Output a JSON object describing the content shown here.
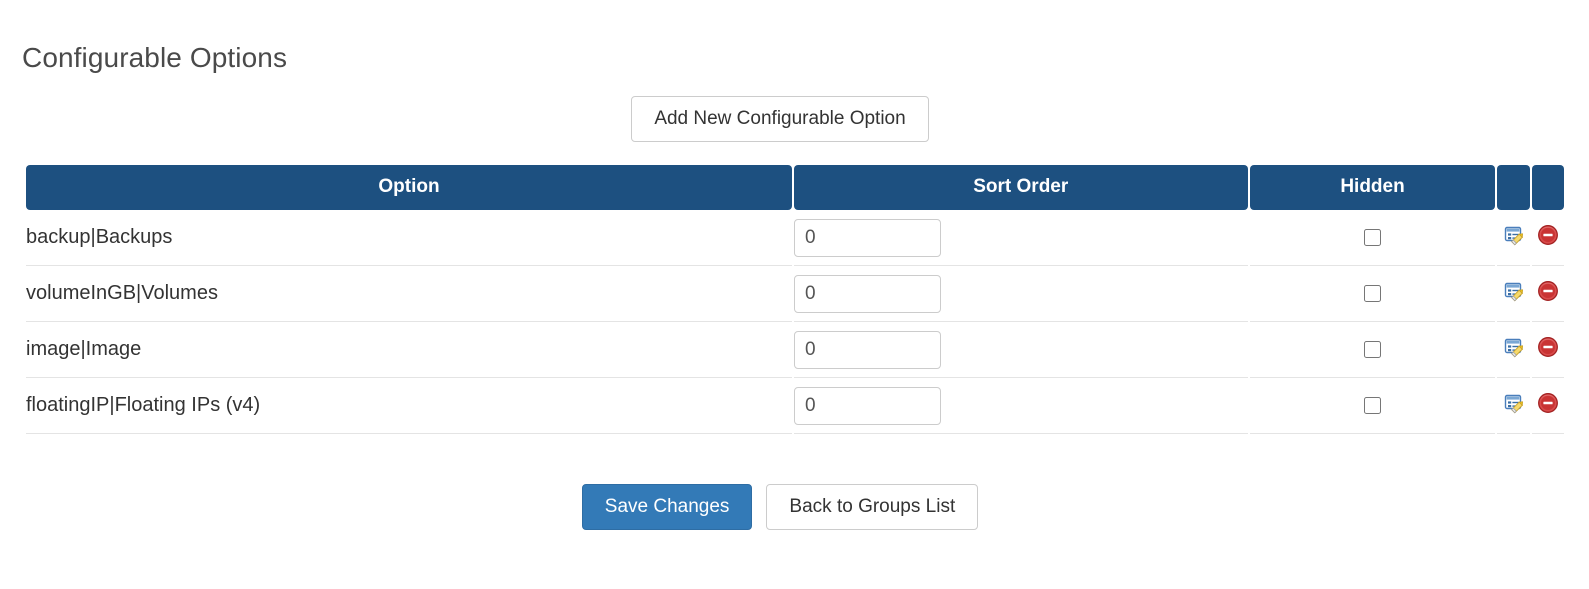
{
  "page": {
    "title": "Configurable Options",
    "add_button_label": "Add New Configurable Option"
  },
  "table": {
    "columns": [
      {
        "key": "option",
        "label": "Option"
      },
      {
        "key": "sort_order",
        "label": "Sort Order"
      },
      {
        "key": "hidden",
        "label": "Hidden"
      },
      {
        "key": "edit",
        "label": ""
      },
      {
        "key": "delete",
        "label": ""
      }
    ],
    "rows": [
      {
        "option": "backup|Backups",
        "sort_order": "0",
        "hidden": false,
        "edit_icon": "edit-icon",
        "delete_icon": "delete-icon"
      },
      {
        "option": "volumeInGB|Volumes",
        "sort_order": "0",
        "hidden": false,
        "edit_icon": "edit-icon",
        "delete_icon": "delete-icon"
      },
      {
        "option": "image|Image",
        "sort_order": "0",
        "hidden": false,
        "edit_icon": "edit-icon",
        "delete_icon": "delete-icon"
      },
      {
        "option": "floatingIP|Floating IPs (v4)",
        "sort_order": "0",
        "hidden": false,
        "edit_icon": "edit-icon",
        "delete_icon": "delete-icon"
      }
    ]
  },
  "footer": {
    "save_label": "Save Changes",
    "back_label": "Back to Groups List"
  },
  "colors": {
    "header_blue": "#1d5080",
    "primary_blue": "#337ab7",
    "border_grey": "#cccccc",
    "row_divider": "#e4e4e4",
    "delete_red": "#cf3434",
    "title_grey": "#4a4a4a"
  }
}
